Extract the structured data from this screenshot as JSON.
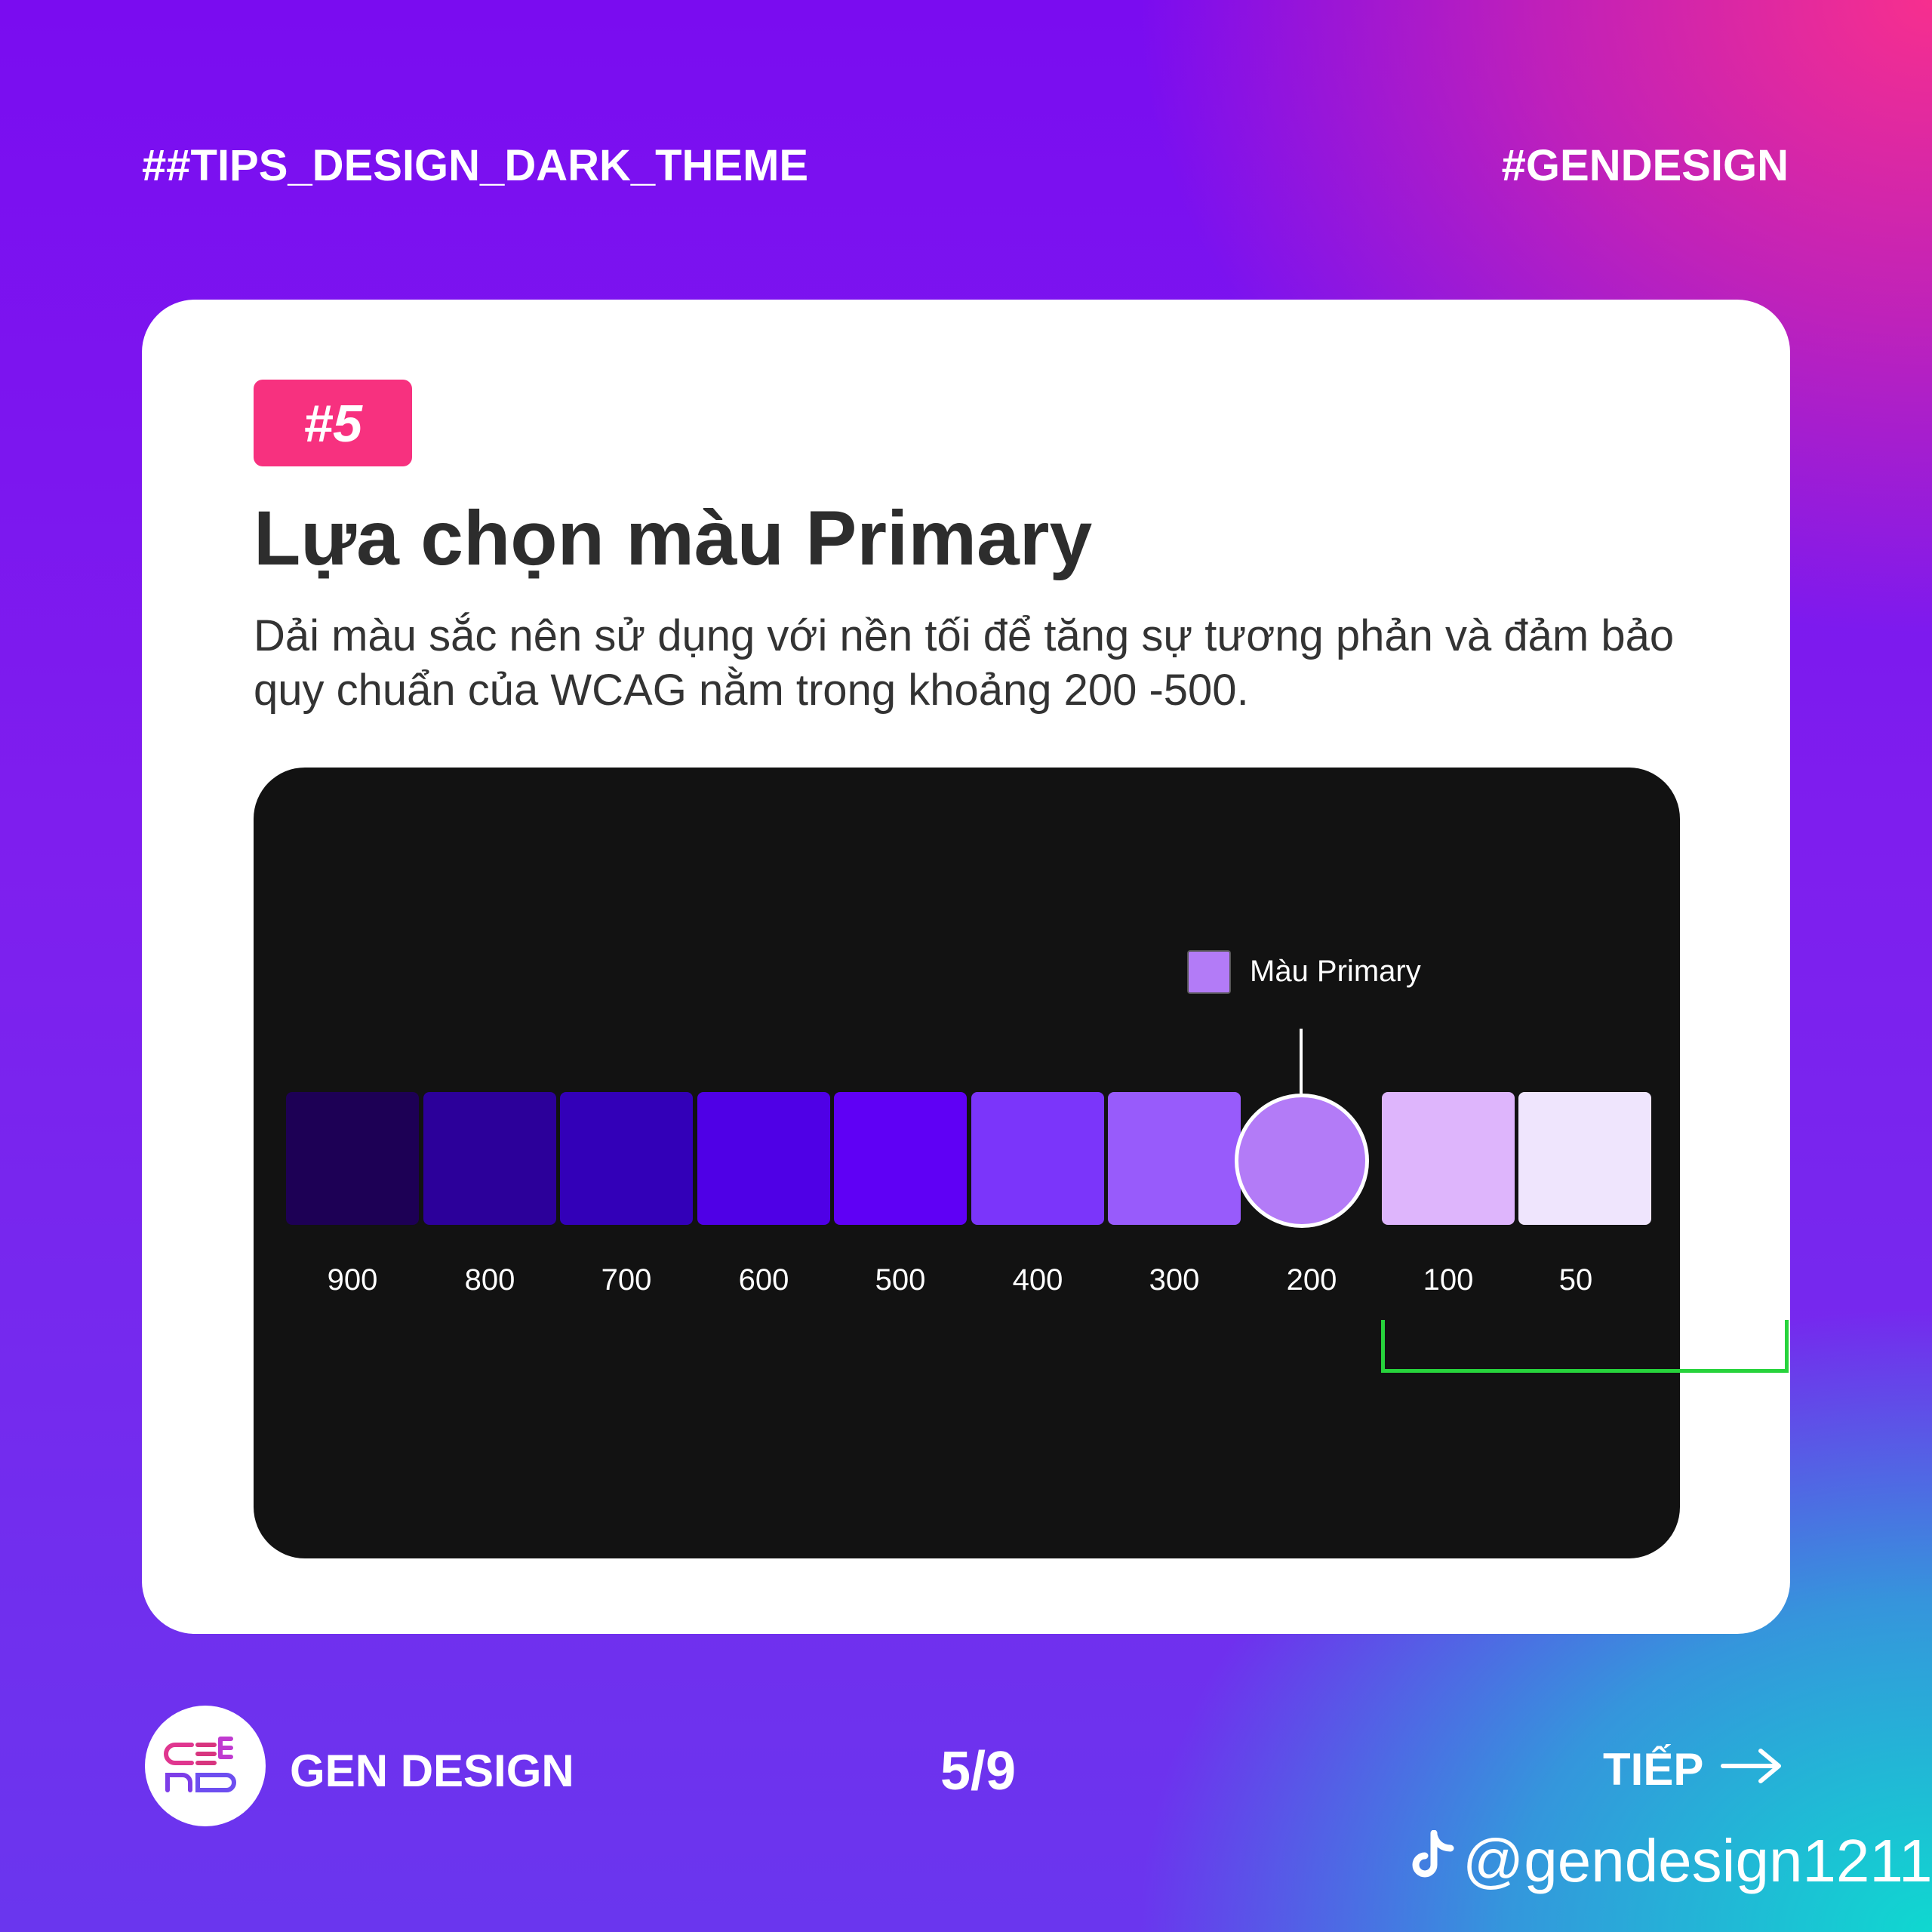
{
  "header": {
    "left_tag": "##TIPS_DESIGN_DARK_THEME",
    "right_tag": "#GENDESIGN"
  },
  "card": {
    "badge": "#5",
    "title": "Lựa chọn màu Primary",
    "description": "Dải màu sắc nên sử dụng với nền tối để tăng sự tương phản và đảm bảo quy chuẩn của WCAG nằm trong khoảng 200 -500."
  },
  "palette": {
    "legend_label": "Màu Primary",
    "legend_color": "#b37bf7",
    "selected": "200",
    "swatches": [
      {
        "label": "900",
        "color": "#1d0055"
      },
      {
        "label": "800",
        "color": "#2c009a"
      },
      {
        "label": "700",
        "color": "#3300b8"
      },
      {
        "label": "600",
        "color": "#4f00e6"
      },
      {
        "label": "500",
        "color": "#5f00f5"
      },
      {
        "label": "400",
        "color": "#7b35fa"
      },
      {
        "label": "300",
        "color": "#985bfb"
      },
      {
        "label": "200",
        "color": "#b37bf7"
      },
      {
        "label": "100",
        "color": "#deb5fc"
      },
      {
        "label": "50",
        "color": "#efe5fd"
      }
    ],
    "range_color": "#27d33c"
  },
  "footer": {
    "brand": "GEN DESIGN",
    "page": "5/9",
    "next_label": "TIẾP",
    "handle": "@gendesign1211"
  }
}
